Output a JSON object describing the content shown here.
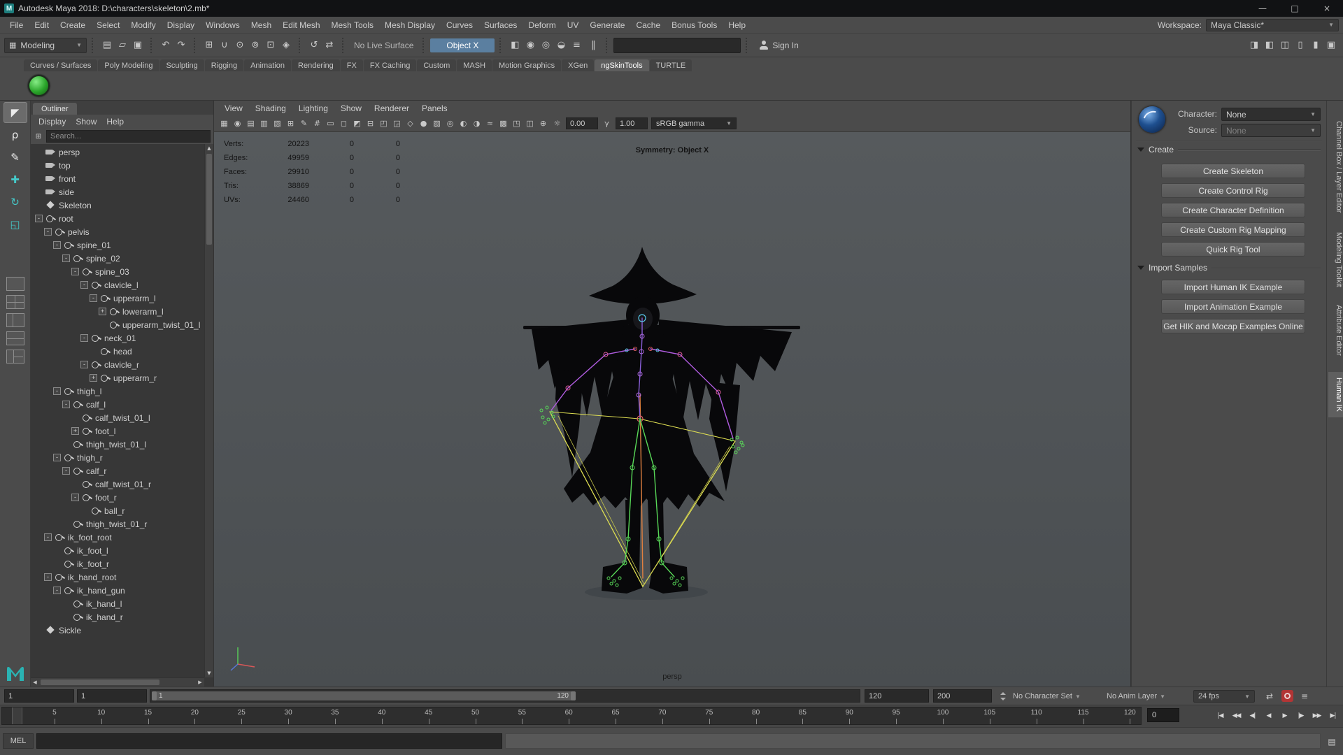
{
  "colors": {
    "accent_blue": "#5b7fa0",
    "autokey_red": "#b23535",
    "ngskin_green": "#2aa52a",
    "maya_teal": "#2ab3b3",
    "viewport_bg": "#515558"
  },
  "window": {
    "title": "Autodesk Maya 2018: D:\\characters\\skeleton\\2.mb*",
    "controls": [
      {
        "name": "minimize-button",
        "glyph": "—"
      },
      {
        "name": "maximize-button",
        "glyph": "□"
      },
      {
        "name": "close-button",
        "glyph": "×"
      }
    ]
  },
  "menu_bar": {
    "items": [
      "File",
      "Edit",
      "Create",
      "Select",
      "Modify",
      "Display",
      "Windows",
      "Mesh",
      "Edit Mesh",
      "Mesh Tools",
      "Mesh Display",
      "Curves",
      "Surfaces",
      "Deform",
      "UV",
      "Generate",
      "Cache",
      "Bonus Tools",
      "Help"
    ],
    "workspace_label": "Workspace:",
    "workspace_value": "Maya Classic*"
  },
  "status_line": {
    "mode_selector": "Modeling",
    "file_icons": [
      {
        "name": "new-scene-icon",
        "glyph": "▤"
      },
      {
        "name": "open-scene-icon",
        "glyph": "▱"
      },
      {
        "name": "save-scene-icon",
        "glyph": "▣"
      }
    ],
    "edit_icons": [
      {
        "name": "undo-icon",
        "glyph": "↶"
      },
      {
        "name": "redo-icon",
        "glyph": "↷"
      }
    ],
    "snap_icons": [
      {
        "name": "snap-to-grid-icon",
        "glyph": "⊞"
      },
      {
        "name": "snap-to-curve-icon",
        "glyph": "∪"
      },
      {
        "name": "snap-to-point-icon",
        "glyph": "⊙"
      },
      {
        "name": "snap-to-projected-center-icon",
        "glyph": "⊚"
      },
      {
        "name": "snap-to-view-plane-icon",
        "glyph": "⊡"
      },
      {
        "name": "make-object-live-icon",
        "glyph": "◈"
      }
    ],
    "history_icons": [
      {
        "name": "construction-history-icon",
        "glyph": "↺"
      },
      {
        "name": "input-output-connections-icon",
        "glyph": "⇄"
      }
    ],
    "no_live_surface": "No Live Surface",
    "symmetry_value": "Object X",
    "render_icons": [
      {
        "name": "open-render-view-icon",
        "glyph": "◧"
      },
      {
        "name": "render-current-frame-icon",
        "glyph": "◉"
      },
      {
        "name": "ipr-render-icon",
        "glyph": "◎"
      },
      {
        "name": "render-sequence-icon",
        "glyph": "◒"
      },
      {
        "name": "render-settings-icon",
        "glyph": "≡"
      }
    ],
    "pause_icon": {
      "name": "interactive-playback-icon",
      "glyph": "‖"
    },
    "sign_in": "Sign In",
    "panel_toggles": [
      {
        "name": "sidebar-toggle-channel-box-icon",
        "glyph": "◨"
      },
      {
        "name": "sidebar-toggle-attribute-editor-icon",
        "glyph": "◧"
      },
      {
        "name": "sidebar-toggle-tool-settings-icon",
        "glyph": "◫"
      },
      {
        "name": "sidebar-toggle-modeling-toolkit-icon",
        "glyph": "▯"
      },
      {
        "name": "sidebar-toggle-humanik-icon",
        "glyph": "▮"
      },
      {
        "name": "sidebar-toggle-panels-icon",
        "glyph": "▣"
      }
    ]
  },
  "shelf": {
    "side_icons": [
      {
        "name": "shelf-tab-switcher-icon",
        "glyph": "▾"
      },
      {
        "name": "shelf-menu-icon",
        "glyph": "≡"
      }
    ],
    "tabs": [
      "Curves / Surfaces",
      "Poly Modeling",
      "Sculpting",
      "Rigging",
      "Animation",
      "Rendering",
      "FX",
      "FX Caching",
      "Custom",
      "MASH",
      "Motion Graphics",
      "XGen",
      "ngSkinTools",
      "TURTLE"
    ],
    "active_tab": "ngSkinTools",
    "items": [
      {
        "name": "ngskintools-init-icon"
      }
    ]
  },
  "toolbox": {
    "tools": [
      {
        "name": "select-tool",
        "glyph": "◤",
        "active": true
      },
      {
        "name": "lasso-tool",
        "glyph": "ρ"
      },
      {
        "name": "paint-selection-tool",
        "glyph": "✎"
      },
      {
        "name": "move-tool",
        "glyph": "✚",
        "teal": true
      },
      {
        "name": "rotate-tool",
        "glyph": "↻",
        "teal": true
      },
      {
        "name": "scale-tool",
        "glyph": "◱",
        "teal": true
      }
    ],
    "layouts": [
      {
        "name": "layout-single-pane",
        "variant": "l-one"
      },
      {
        "name": "layout-four-pane",
        "variant": "l-four"
      },
      {
        "name": "layout-two-pane-side",
        "variant": "l-side"
      },
      {
        "name": "layout-two-pane-stacked",
        "variant": "l-stack"
      },
      {
        "name": "layout-outliner-persp",
        "variant": "l-outl"
      }
    ]
  },
  "outliner": {
    "panel_title": "Outliner",
    "menus": [
      "Display",
      "Show",
      "Help"
    ],
    "search_placeholder": "Search...",
    "tree": [
      {
        "label": "persp",
        "depth": 0,
        "expander": "none",
        "icon": "camera"
      },
      {
        "label": "top",
        "depth": 0,
        "expander": "none",
        "icon": "camera"
      },
      {
        "label": "front",
        "depth": 0,
        "expander": "none",
        "icon": "camera"
      },
      {
        "label": "side",
        "depth": 0,
        "expander": "none",
        "icon": "camera"
      },
      {
        "label": "Skeleton",
        "depth": 0,
        "expander": "none",
        "icon": "transform"
      },
      {
        "label": "root",
        "depth": 0,
        "expander": "minus",
        "icon": "joint"
      },
      {
        "label": "pelvis",
        "depth": 1,
        "expander": "minus",
        "icon": "joint"
      },
      {
        "label": "spine_01",
        "depth": 2,
        "expander": "minus",
        "icon": "joint"
      },
      {
        "label": "spine_02",
        "depth": 3,
        "expander": "minus",
        "icon": "joint"
      },
      {
        "label": "spine_03",
        "depth": 4,
        "expander": "minus",
        "icon": "joint"
      },
      {
        "label": "clavicle_l",
        "depth": 5,
        "expander": "minus",
        "icon": "joint"
      },
      {
        "label": "upperarm_l",
        "depth": 6,
        "expander": "minus",
        "icon": "joint"
      },
      {
        "label": "lowerarm_l",
        "depth": 7,
        "expander": "plus",
        "icon": "joint"
      },
      {
        "label": "upperarm_twist_01_l",
        "depth": 7,
        "expander": "none",
        "icon": "joint"
      },
      {
        "label": "neck_01",
        "depth": 5,
        "expander": "minus",
        "icon": "joint"
      },
      {
        "label": "head",
        "depth": 6,
        "expander": "none",
        "icon": "joint"
      },
      {
        "label": "clavicle_r",
        "depth": 5,
        "expander": "minus",
        "icon": "joint"
      },
      {
        "label": "upperarm_r",
        "depth": 6,
        "expander": "plus",
        "icon": "joint"
      },
      {
        "label": "thigh_l",
        "depth": 2,
        "expander": "minus",
        "icon": "joint"
      },
      {
        "label": "calf_l",
        "depth": 3,
        "expander": "minus",
        "icon": "joint"
      },
      {
        "label": "calf_twist_01_l",
        "depth": 4,
        "expander": "none",
        "icon": "joint"
      },
      {
        "label": "foot_l",
        "depth": 4,
        "expander": "plus",
        "icon": "joint"
      },
      {
        "label": "thigh_twist_01_l",
        "depth": 3,
        "expander": "none",
        "icon": "joint"
      },
      {
        "label": "thigh_r",
        "depth": 2,
        "expander": "minus",
        "icon": "joint"
      },
      {
        "label": "calf_r",
        "depth": 3,
        "expander": "minus",
        "icon": "joint"
      },
      {
        "label": "calf_twist_01_r",
        "depth": 4,
        "expander": "none",
        "icon": "joint"
      },
      {
        "label": "foot_r",
        "depth": 4,
        "expander": "minus",
        "icon": "joint"
      },
      {
        "label": "ball_r",
        "depth": 5,
        "expander": "none",
        "icon": "joint"
      },
      {
        "label": "thigh_twist_01_r",
        "depth": 3,
        "expander": "none",
        "icon": "joint"
      },
      {
        "label": "ik_foot_root",
        "depth": 1,
        "expander": "minus",
        "icon": "joint"
      },
      {
        "label": "ik_foot_l",
        "depth": 2,
        "expander": "none",
        "icon": "joint"
      },
      {
        "label": "ik_foot_r",
        "depth": 2,
        "expander": "none",
        "icon": "joint"
      },
      {
        "label": "ik_hand_root",
        "depth": 1,
        "expander": "minus",
        "icon": "joint"
      },
      {
        "label": "ik_hand_gun",
        "depth": 2,
        "expander": "minus",
        "icon": "joint"
      },
      {
        "label": "ik_hand_l",
        "depth": 3,
        "expander": "none",
        "icon": "joint"
      },
      {
        "label": "ik_hand_r",
        "depth": 3,
        "expander": "none",
        "icon": "joint"
      },
      {
        "label": "Sickle",
        "depth": 0,
        "expander": "none",
        "icon": "transform"
      }
    ]
  },
  "viewport": {
    "menus": [
      "View",
      "Shading",
      "Lighting",
      "Show",
      "Renderer",
      "Panels"
    ],
    "toolbar_icons": [
      {
        "name": "select-camera-icon",
        "glyph": "▦"
      },
      {
        "name": "lock-camera-icon",
        "glyph": "◉"
      },
      {
        "name": "camera-attributes-icon",
        "glyph": "▤"
      },
      {
        "name": "bookmarks-icon",
        "glyph": "▥"
      },
      {
        "name": "image-plane-icon",
        "glyph": "▧"
      },
      {
        "name": "two-d-pan-zoom-icon",
        "glyph": "⊞"
      },
      {
        "name": "grease-pencil-icon",
        "glyph": "✎"
      },
      {
        "name": "grid-icon",
        "glyph": "#"
      },
      {
        "name": "film-gate-icon",
        "glyph": "▭"
      },
      {
        "name": "resolution-gate-icon",
        "glyph": "◻"
      },
      {
        "name": "gate-mask-icon",
        "glyph": "◩"
      },
      {
        "name": "field-chart-icon",
        "glyph": "⊟"
      },
      {
        "name": "safe-action-icon",
        "glyph": "◰"
      },
      {
        "name": "safe-title-icon",
        "glyph": "◲"
      },
      {
        "name": "wireframe-icon",
        "glyph": "◇"
      },
      {
        "name": "smooth-shade-icon",
        "glyph": "●"
      },
      {
        "name": "textured-icon",
        "glyph": "▨"
      },
      {
        "name": "use-default-material-icon",
        "glyph": "◎"
      },
      {
        "name": "shadows-icon",
        "glyph": "◐"
      },
      {
        "name": "ambient-occlusion-icon",
        "glyph": "◑"
      },
      {
        "name": "motion-blur-icon",
        "glyph": "≈"
      },
      {
        "name": "anti-aliasing-icon",
        "glyph": "▩"
      },
      {
        "name": "isolate-select-icon",
        "glyph": "◳"
      },
      {
        "name": "xray-icon",
        "glyph": "◫"
      },
      {
        "name": "xray-joints-icon",
        "glyph": "⊕"
      }
    ],
    "exposure_icon": {
      "name": "exposure-icon",
      "glyph": "☼"
    },
    "exposure": "0.00",
    "gamma_icon": {
      "name": "gamma-icon",
      "glyph": "γ"
    },
    "gamma": "1.00",
    "view_transform": "sRGB gamma",
    "stats": {
      "rows": [
        [
          "Verts:",
          "20223",
          "0",
          "0"
        ],
        [
          "Edges:",
          "49959",
          "0",
          "0"
        ],
        [
          "Faces:",
          "29910",
          "0",
          "0"
        ],
        [
          "Tris:",
          "38869",
          "0",
          "0"
        ],
        [
          "UVs:",
          "24460",
          "0",
          "0"
        ]
      ]
    },
    "symmetry_hud": "Symmetry: Object X",
    "camera_label": "persp"
  },
  "humanik_panel": {
    "character_label": "Character:",
    "character_value": "None",
    "source_label": "Source:",
    "source_value": "None",
    "sections": [
      {
        "title": "Create",
        "buttons": [
          "Create Skeleton",
          "Create Control Rig",
          "Create Character Definition",
          "Create Custom Rig Mapping",
          "Quick Rig Tool"
        ]
      },
      {
        "title": "Import Samples",
        "buttons": [
          "Import Human IK Example",
          "Import Animation Example",
          "Get HIK and Mocap Examples Online"
        ]
      }
    ]
  },
  "right_tabs": {
    "items": [
      "Channel Box / Layer Editor",
      "Modeling Toolkit",
      "Attribute Editor",
      "Human IK"
    ],
    "active": "Human IK"
  },
  "timeline": {
    "playback_start": "1",
    "anim_start": "1",
    "range_label_start": "1",
    "range_label_end": "120",
    "playback_end": "120",
    "anim_end": "200",
    "character_set": "No Character Set",
    "anim_layer": "No Anim Layer",
    "fps": "24 fps",
    "current_frame": "0",
    "ruler_ticks": [
      5,
      10,
      15,
      20,
      25,
      30,
      35,
      40,
      45,
      50,
      55,
      60,
      65,
      70,
      75,
      80,
      85,
      90,
      95,
      100,
      105,
      110,
      115,
      120
    ]
  },
  "playback_controls": [
    {
      "name": "go-to-start-button",
      "glyph": "|◀"
    },
    {
      "name": "step-back-frame-button",
      "glyph": "◀◀"
    },
    {
      "name": "step-back-key-button",
      "glyph": "◀|"
    },
    {
      "name": "play-backwards-button",
      "glyph": "◀"
    },
    {
      "name": "play-forwards-button",
      "glyph": "▶"
    },
    {
      "name": "step-forward-key-button",
      "glyph": "|▶"
    },
    {
      "name": "step-forward-frame-button",
      "glyph": "▶▶"
    },
    {
      "name": "go-to-end-button",
      "glyph": "▶|"
    }
  ],
  "command_line": {
    "label": "MEL"
  }
}
